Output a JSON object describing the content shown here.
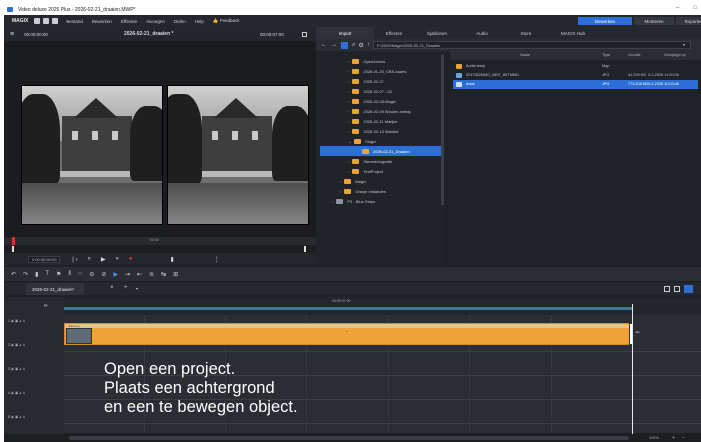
{
  "window": {
    "title": "Video deluxe 2025 Plus - 2026-02-21_draaien.MWP*",
    "controls": [
      "–",
      "□",
      "×"
    ]
  },
  "menubar": {
    "logo": "MAGIX",
    "items": [
      "Bestand",
      "Bewerken",
      "Effecten",
      "Invoegen",
      "Delen",
      "Help"
    ],
    "feedback": "Feedback",
    "modes": [
      {
        "label": "Bewerken",
        "active": true
      },
      {
        "label": "Monteren",
        "active": false
      },
      {
        "label": "Exporteren",
        "active": false
      }
    ]
  },
  "preview": {
    "timecode_left": "00:00:00:00",
    "project_name": "2026-02-21_draaien *",
    "timecode_right": "00:00:07:00",
    "ruler_mark": "00:00",
    "position_display": "0:00:00:00:00"
  },
  "browser": {
    "tabs": [
      {
        "label": "Import",
        "active": true
      },
      {
        "label": "Effecten",
        "active": false
      },
      {
        "label": "Sjablonen",
        "active": false
      },
      {
        "label": "Audio",
        "active": false
      },
      {
        "label": "Store",
        "active": false
      },
      {
        "label": "MAGIX Hub",
        "active": false
      }
    ],
    "path": "F:\\2025\\Magix\\2026-02-21_Draaien",
    "tree": [
      {
        "label": "OpenAnimis",
        "selected": false
      },
      {
        "label": "2026-01-20_CBS-kaarts",
        "selected": false
      },
      {
        "label": "2025-02-07",
        "selected": false
      },
      {
        "label": "2026-02-07 - 02",
        "selected": false
      },
      {
        "label": "2026-02-08-Magix",
        "selected": false
      },
      {
        "label": "2026-02-09 Woolen ambaj",
        "selected": false
      },
      {
        "label": "2026-02-11 Marijke",
        "selected": false
      },
      {
        "label": "2026-02-13 Wandel",
        "selected": false
      },
      {
        "label": "Magix",
        "selected": false
      },
      {
        "label": "2026-02-21_Draaien",
        "selected": true
      },
      {
        "label": "Stereofotografie",
        "selected": false
      },
      {
        "label": "TestProject",
        "selected": false
      },
      {
        "label": "Magix",
        "selected": false
      },
      {
        "label": "Oranje Instanden",
        "selected": false
      },
      {
        "label": "P3 - Blue Strips",
        "selected": false
      }
    ],
    "columns": [
      "Naam",
      "Type",
      "Grootte",
      "Gewijzigd op"
    ],
    "files": [
      {
        "name": "Audio temp",
        "type": "Map",
        "size": "",
        "date": "",
        "selected": false,
        "kind": "folder"
      },
      {
        "name": "20170526IMG_0697_8KTMMG",
        "type": "JPG",
        "size": "41.229 KB",
        "date": "9-2-2026 11:20:26",
        "selected": false,
        "kind": "image"
      },
      {
        "name": "draai",
        "type": "JPG",
        "size": "773.208 KB",
        "date": "9-2-2026 10:03:46",
        "selected": true,
        "kind": "image"
      }
    ]
  },
  "timeline": {
    "tab_label": "2026-02-21_draaien*",
    "ruler_label": "00:00:07:00",
    "track_numbers": [
      "1",
      "2",
      "3",
      "4",
      "5"
    ],
    "clip_name": "draai.jpg",
    "zoom_label": "100%"
  },
  "caption": {
    "lines": "Open een project.\nPlaats een achtergrond\nen een te bewegen object."
  },
  "colors": {
    "accent": "#2c6fd6",
    "clip": "#f0a33a",
    "folder": "#e8a33a",
    "record": "#d8322b"
  }
}
